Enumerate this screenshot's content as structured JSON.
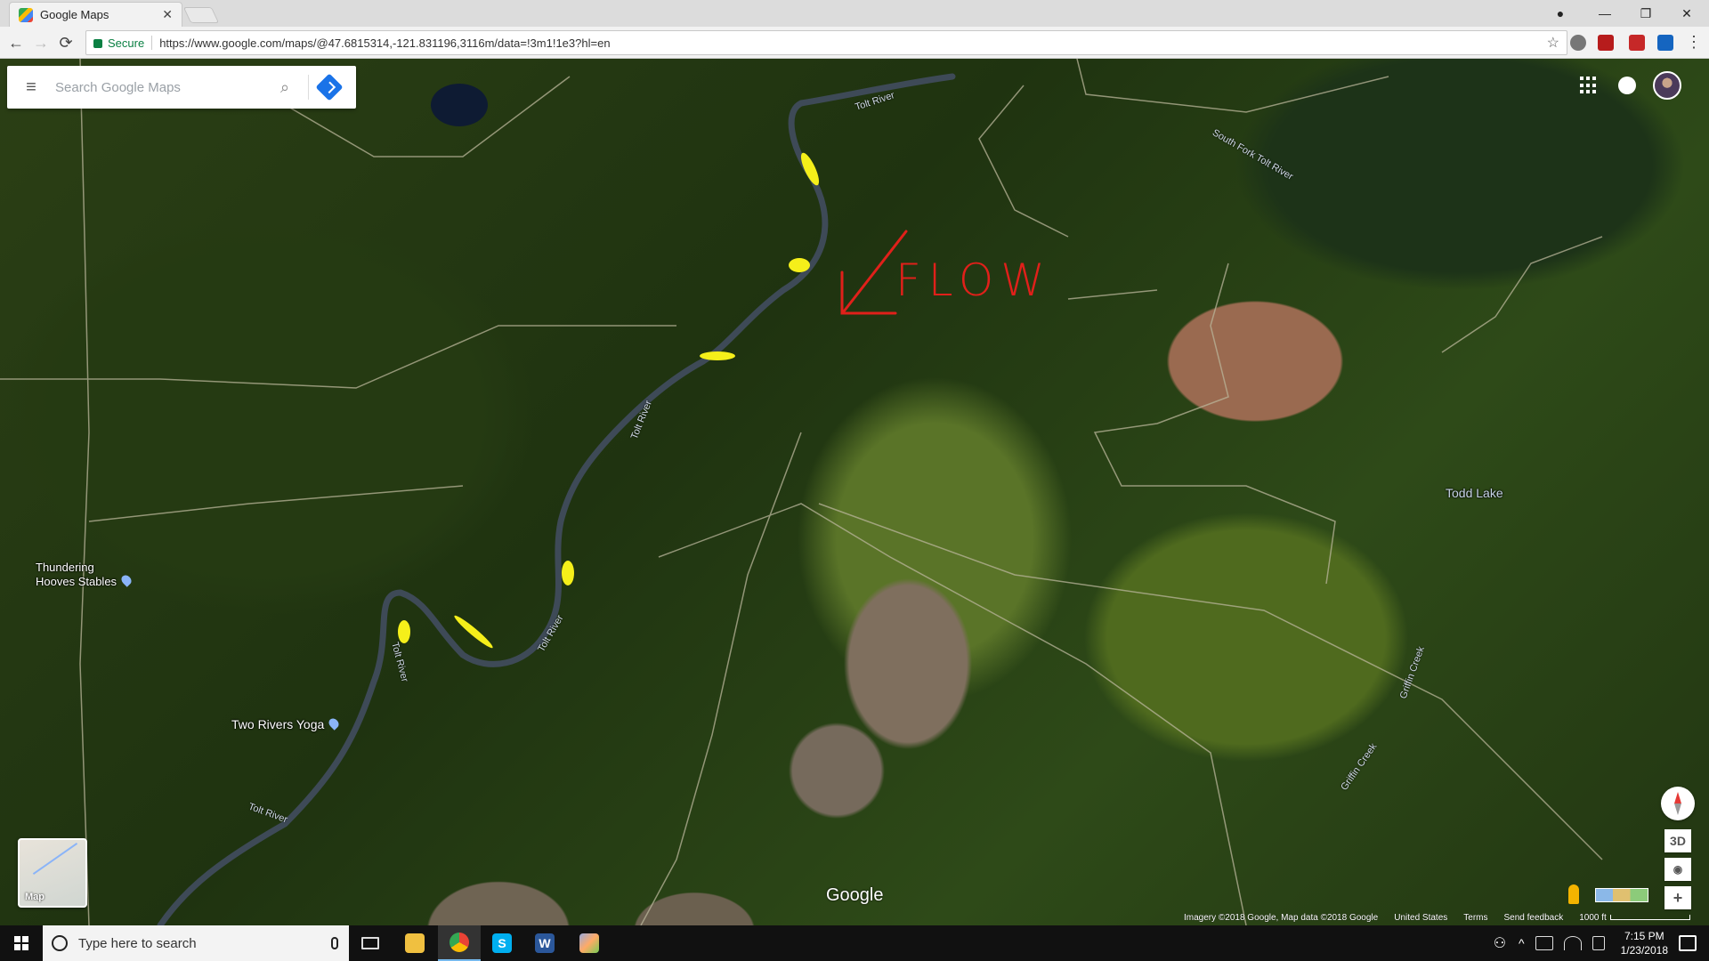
{
  "browser": {
    "tab_title": "Google Maps",
    "tab_close": "✕",
    "back": "←",
    "forward": "→",
    "reload": "⟳",
    "secure_label": "Secure",
    "url": "https://www.google.com/maps/@47.6815314,-121.831196,3116m/data=!3m1!1e3?hl=en",
    "star": "☆",
    "menu": "⋮",
    "win_account": "●",
    "win_min": "—",
    "win_restore": "❐",
    "win_close": "✕"
  },
  "maps": {
    "search_placeholder": "Search Google Maps",
    "hamburger": "≡",
    "search_glyph": "⌕",
    "layer_thumb_label": "Map",
    "logo": "Google",
    "ctl_3d": "3D",
    "ctl_locate": "◉",
    "ctl_zoom_in": "+",
    "ctl_zoom_out": "−",
    "ctl_expand": "⌃",
    "attribution": {
      "imagery": "Imagery ©2018 Google, Map data ©2018 Google",
      "country": "United States",
      "terms": "Terms",
      "feedback": "Send feedback",
      "scale": "1000 ft"
    },
    "place_labels": {
      "thundering": "Thundering Hooves Stables",
      "two_rivers": "Two Rivers Yoga",
      "todd_lake": "Todd Lake"
    },
    "river_labels": {
      "tolt_top": "Tolt River",
      "tolt_mid": "Tolt River",
      "tolt_low": "Tolt River",
      "tolt_left": "Tolt River",
      "tolt_bottom": "Tolt River",
      "south_fork": "South Fork Tolt River",
      "griffin_upper": "Griffin Creek",
      "griffin_lower": "Griffin Creek"
    },
    "annotation": {
      "flow_text": "FLOW",
      "arrow_color": "#e0201a",
      "highlight_color": "#f5ef1a"
    }
  },
  "taskbar": {
    "search_placeholder": "Type here to search",
    "time": "7:15 PM",
    "date": "1/23/2018",
    "apps": {
      "task_view": "Task View",
      "explorer": "File Explorer",
      "chrome": "Google Chrome",
      "skype": "S",
      "word": "W",
      "paint": "Paint"
    },
    "tray": {
      "people": "⚇",
      "chevron": "^"
    }
  },
  "colors": {
    "accent_blue": "#1a73e8",
    "secure_green": "#0b8043"
  }
}
